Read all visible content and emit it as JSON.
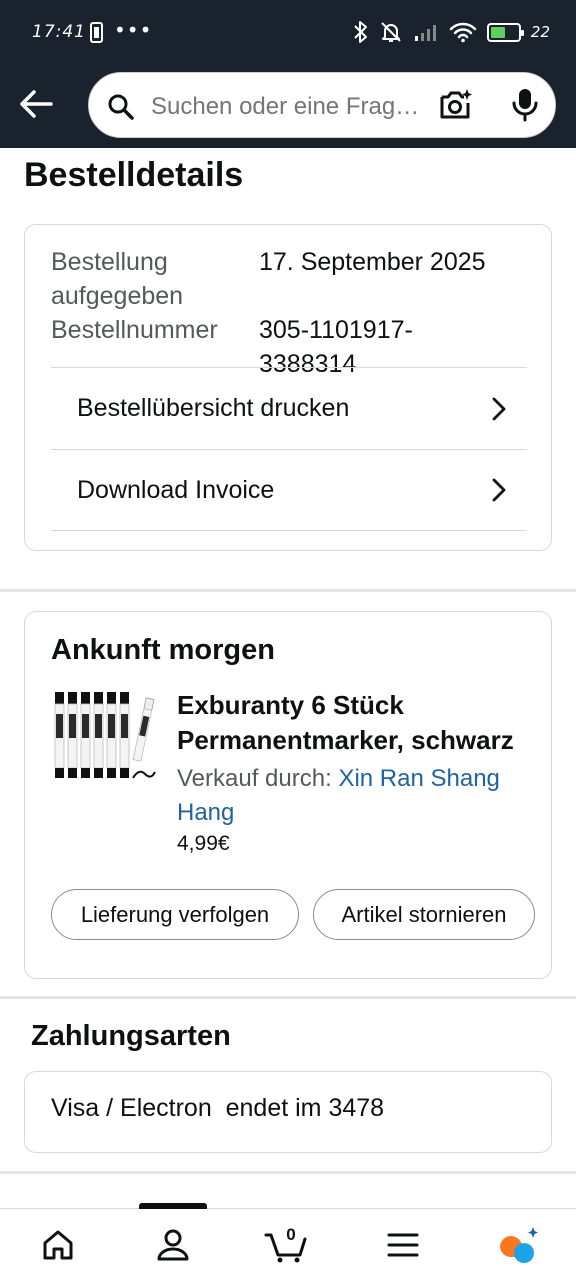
{
  "status_bar": {
    "time": "17:41",
    "dots": "•••",
    "battery_percent": "22",
    "battery_level": 0.22,
    "battery_color": "#5fd05f"
  },
  "header": {
    "back_icon": "arrow-left-icon",
    "search_placeholder": "Suchen oder eine Frage stellen",
    "camera_icon": "camera-lens-icon",
    "mic_icon": "microphone-icon"
  },
  "page_title": "Bestelldetails",
  "order_info": {
    "placed_label": "Bestellung aufgegeben",
    "placed_label_line1": "Bestellung",
    "placed_label_line2": "aufgegeben",
    "placed_value": "17. September 2025",
    "number_label": "Bestellnummer",
    "number_value_line1": "305-1101917-",
    "number_value_line2": "3388314",
    "links": [
      {
        "label": "Bestellübersicht drucken",
        "icon": "chevron-right-icon"
      },
      {
        "label": "Download Invoice",
        "icon": "chevron-right-icon"
      }
    ]
  },
  "delivery": {
    "title": "Ankunft morgen",
    "product": {
      "title_line1": "Exburanty 6 Stück",
      "title_line2": "Permanentmarker, schwarz",
      "seller_prefix": "Verkauf durch: ",
      "seller_name_line1": "Xin Ran Shang",
      "seller_name_line2": "Hang",
      "price": "4,99€",
      "image_icon": "marker-pens-image"
    },
    "buttons": {
      "track": "Lieferung verfolgen",
      "cancel": "Artikel stornieren"
    }
  },
  "payments": {
    "title": "Zahlungsarten",
    "method": "Visa / Electron  endet im 3478"
  },
  "bottom_nav": {
    "items": [
      "home-icon",
      "account-icon",
      "cart-icon",
      "menu-icon",
      "rufus-icon"
    ],
    "cart_count": "0",
    "active": "account-icon"
  },
  "colors": {
    "header_bg": "#1a222e",
    "link_blue": "#2162a1",
    "rufus_orange": "#f7781e",
    "rufus_blue": "#1aa3e8"
  }
}
